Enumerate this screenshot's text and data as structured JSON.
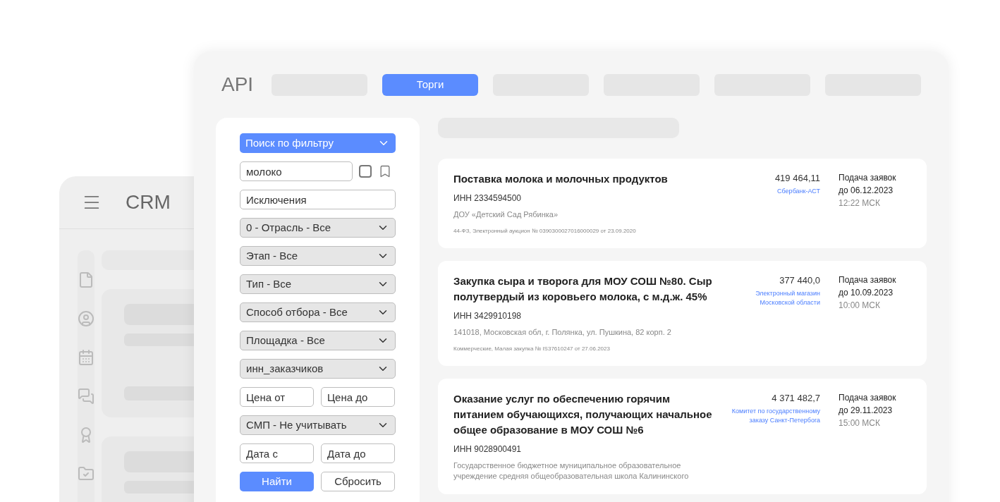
{
  "crm_window": {
    "title": "CRM"
  },
  "api_window": {
    "title": "API",
    "tabs": [
      {
        "selected": false
      },
      {
        "label": "Торги",
        "selected": true
      },
      {
        "selected": false
      },
      {
        "selected": false
      },
      {
        "selected": false
      },
      {
        "selected": false
      }
    ],
    "filters": [
      {
        "kind": "primary_select",
        "value": "Поиск по фильтру"
      },
      {
        "kind": "search",
        "value": "молоко",
        "checked": false
      },
      {
        "kind": "input",
        "placeholder": "Исключения"
      },
      {
        "kind": "select",
        "value": "0 - Отрасль - Все"
      },
      {
        "kind": "select",
        "value": "Этап - Все"
      },
      {
        "kind": "select",
        "value": "Тип - Все"
      },
      {
        "kind": "select",
        "value": "Способ отбора - Все"
      },
      {
        "kind": "select",
        "value": "Площадка - Все"
      },
      {
        "kind": "select",
        "value": "инн_заказчиков"
      },
      {
        "kind": "range",
        "from_placeholder": "Цена от",
        "to_placeholder": "Цена до"
      },
      {
        "kind": "select",
        "value": "СМП - Не учитывать"
      },
      {
        "kind": "range",
        "from_placeholder": "Дата с",
        "to_placeholder": "Дата до"
      },
      {
        "kind": "buttons",
        "buttons": [
          {
            "label": "Найти",
            "primary": true
          },
          {
            "label": "Сбросить",
            "primary": false
          }
        ]
      }
    ],
    "results": [
      {
        "title": "Поставка молока и молочных продуктов",
        "inn": "ИНН 2334594500",
        "customer": "ДОУ «Детский Сад Рябинка»",
        "details": "44-ФЗ, Электронный аукцион № 0390300027016000029 от 23.09.2020",
        "price": "419 464,11",
        "platform": "Сбербанк-АСТ",
        "deadline_label": "Подача заявок",
        "deadline_date": "до 06.12.2023",
        "deadline_time": "12:22 МСК"
      },
      {
        "title": "Закупка сыра и творога для МОУ СОШ №80. Сыр полутвердый из коровьего молока, с м.д.ж. 45%",
        "inn": "ИНН 3429910198",
        "customer": "141018, Московская обл, г. Полянка, ул. Пушкина, 82 корп. 2",
        "details": "Коммерческие, Малая закупка № IS37610247 от 27.06.2023",
        "price": "377 440,0",
        "platform": "Электронный магазин Московской области",
        "deadline_label": "Подача заявок",
        "deadline_date": "до 10.09.2023",
        "deadline_time": "10:00 МСК"
      },
      {
        "title": "Оказание услуг по обеспечению горячим питанием обучающихся, получающих начальное общее образование в МОУ СОШ №6",
        "inn": "ИНН 9028900491",
        "customer": "Государственное бюджетное муниципальное образовательное учреждение средняя общеобразовательная школа Калининского",
        "price": "4 371 482,7",
        "platform": "Комитет по государственному заказу Санкт-Петербога",
        "deadline_label": "Подача заявок",
        "deadline_date": "до 29.11.2023",
        "deadline_time": "15:00 МСК"
      }
    ]
  }
}
